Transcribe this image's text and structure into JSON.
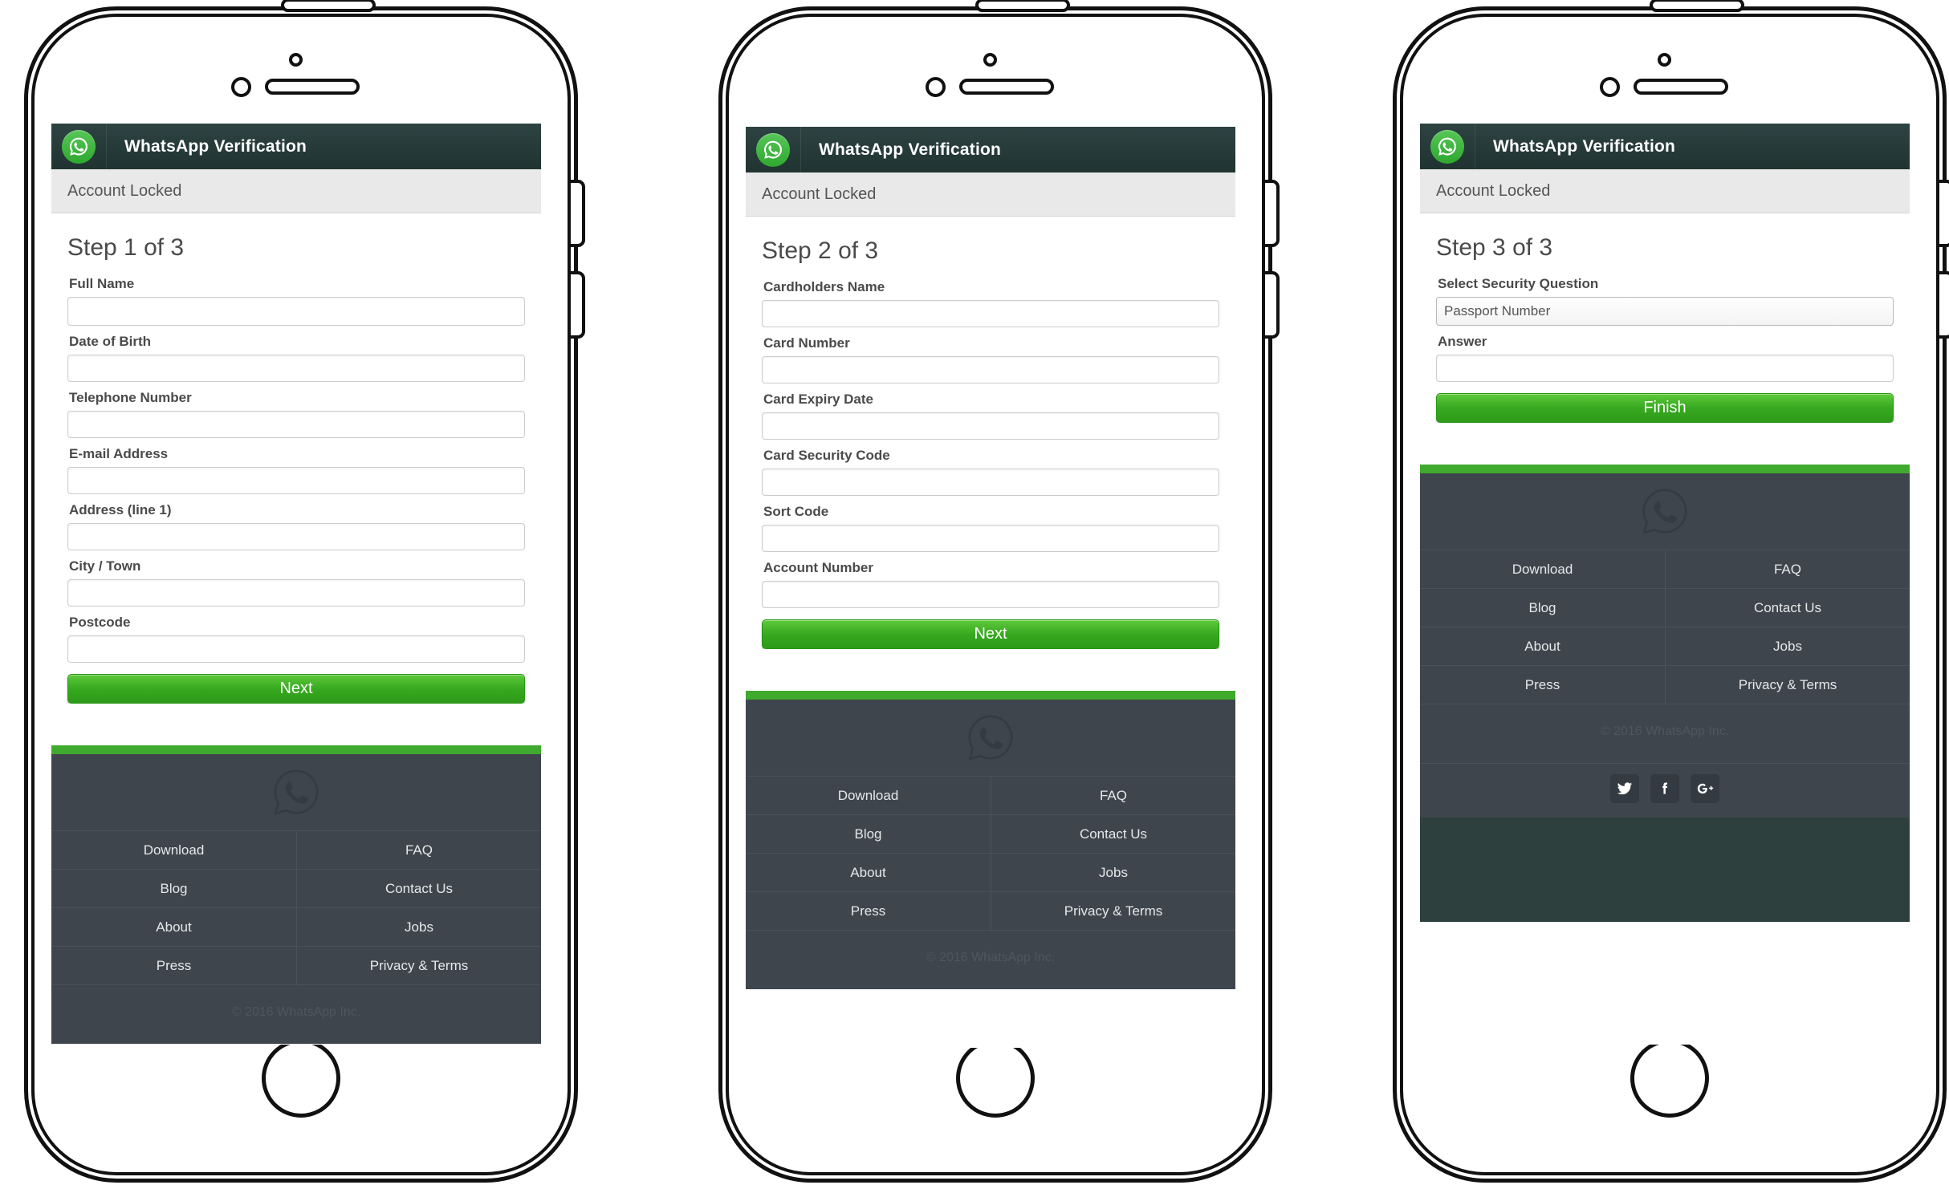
{
  "app": {
    "title": "WhatsApp Verification",
    "status_bar": "Account Locked",
    "logo_icon": "whatsapp-icon"
  },
  "colors": {
    "header_bg": "#2d4342",
    "accent_green": "#3faa2d",
    "button_green_top": "#5ec93b",
    "button_green_bottom": "#2e9a19",
    "footer_bg": "#3e454d",
    "subbar_bg": "#e9e9e9",
    "teal_tail": "#2e403e"
  },
  "screens": [
    {
      "step_title": "Step 1 of 3",
      "fields": [
        {
          "label": "Full Name",
          "value": "",
          "placeholder": ""
        },
        {
          "label": "Date of Birth",
          "value": "",
          "placeholder": ""
        },
        {
          "label": "Telephone Number",
          "value": "",
          "placeholder": ""
        },
        {
          "label": "E-mail Address",
          "value": "",
          "placeholder": ""
        },
        {
          "label": "Address (line 1)",
          "value": "",
          "placeholder": ""
        },
        {
          "label": "City / Town",
          "value": "",
          "placeholder": ""
        },
        {
          "label": "Postcode",
          "value": "",
          "placeholder": ""
        }
      ],
      "submit_label": "Next"
    },
    {
      "step_title": "Step 2 of 3",
      "fields": [
        {
          "label": "Cardholders Name",
          "value": "",
          "placeholder": ""
        },
        {
          "label": "Card Number",
          "value": "",
          "placeholder": ""
        },
        {
          "label": "Card Expiry Date",
          "value": "",
          "placeholder": ""
        },
        {
          "label": "Card Security Code",
          "value": "",
          "placeholder": ""
        },
        {
          "label": "Sort Code",
          "value": "",
          "placeholder": ""
        },
        {
          "label": "Account Number",
          "value": "",
          "placeholder": ""
        }
      ],
      "submit_label": "Next"
    },
    {
      "step_title": "Step 3 of 3",
      "select_label": "Select Security Question",
      "select_value": "Passport Number",
      "answer_label": "Answer",
      "answer_value": "",
      "submit_label": "Finish"
    }
  ],
  "footer": {
    "links": [
      "Download",
      "FAQ",
      "Blog",
      "Contact Us",
      "About",
      "Jobs",
      "Press",
      "Privacy & Terms"
    ],
    "copyright": "© 2016 WhatsApp Inc.",
    "social": [
      {
        "name": "twitter-icon",
        "glyph": "twitter"
      },
      {
        "name": "facebook-icon",
        "glyph": "facebook"
      },
      {
        "name": "google-plus-icon",
        "glyph": "gplus"
      }
    ],
    "watermark_icon": "whatsapp-watermark-icon"
  }
}
